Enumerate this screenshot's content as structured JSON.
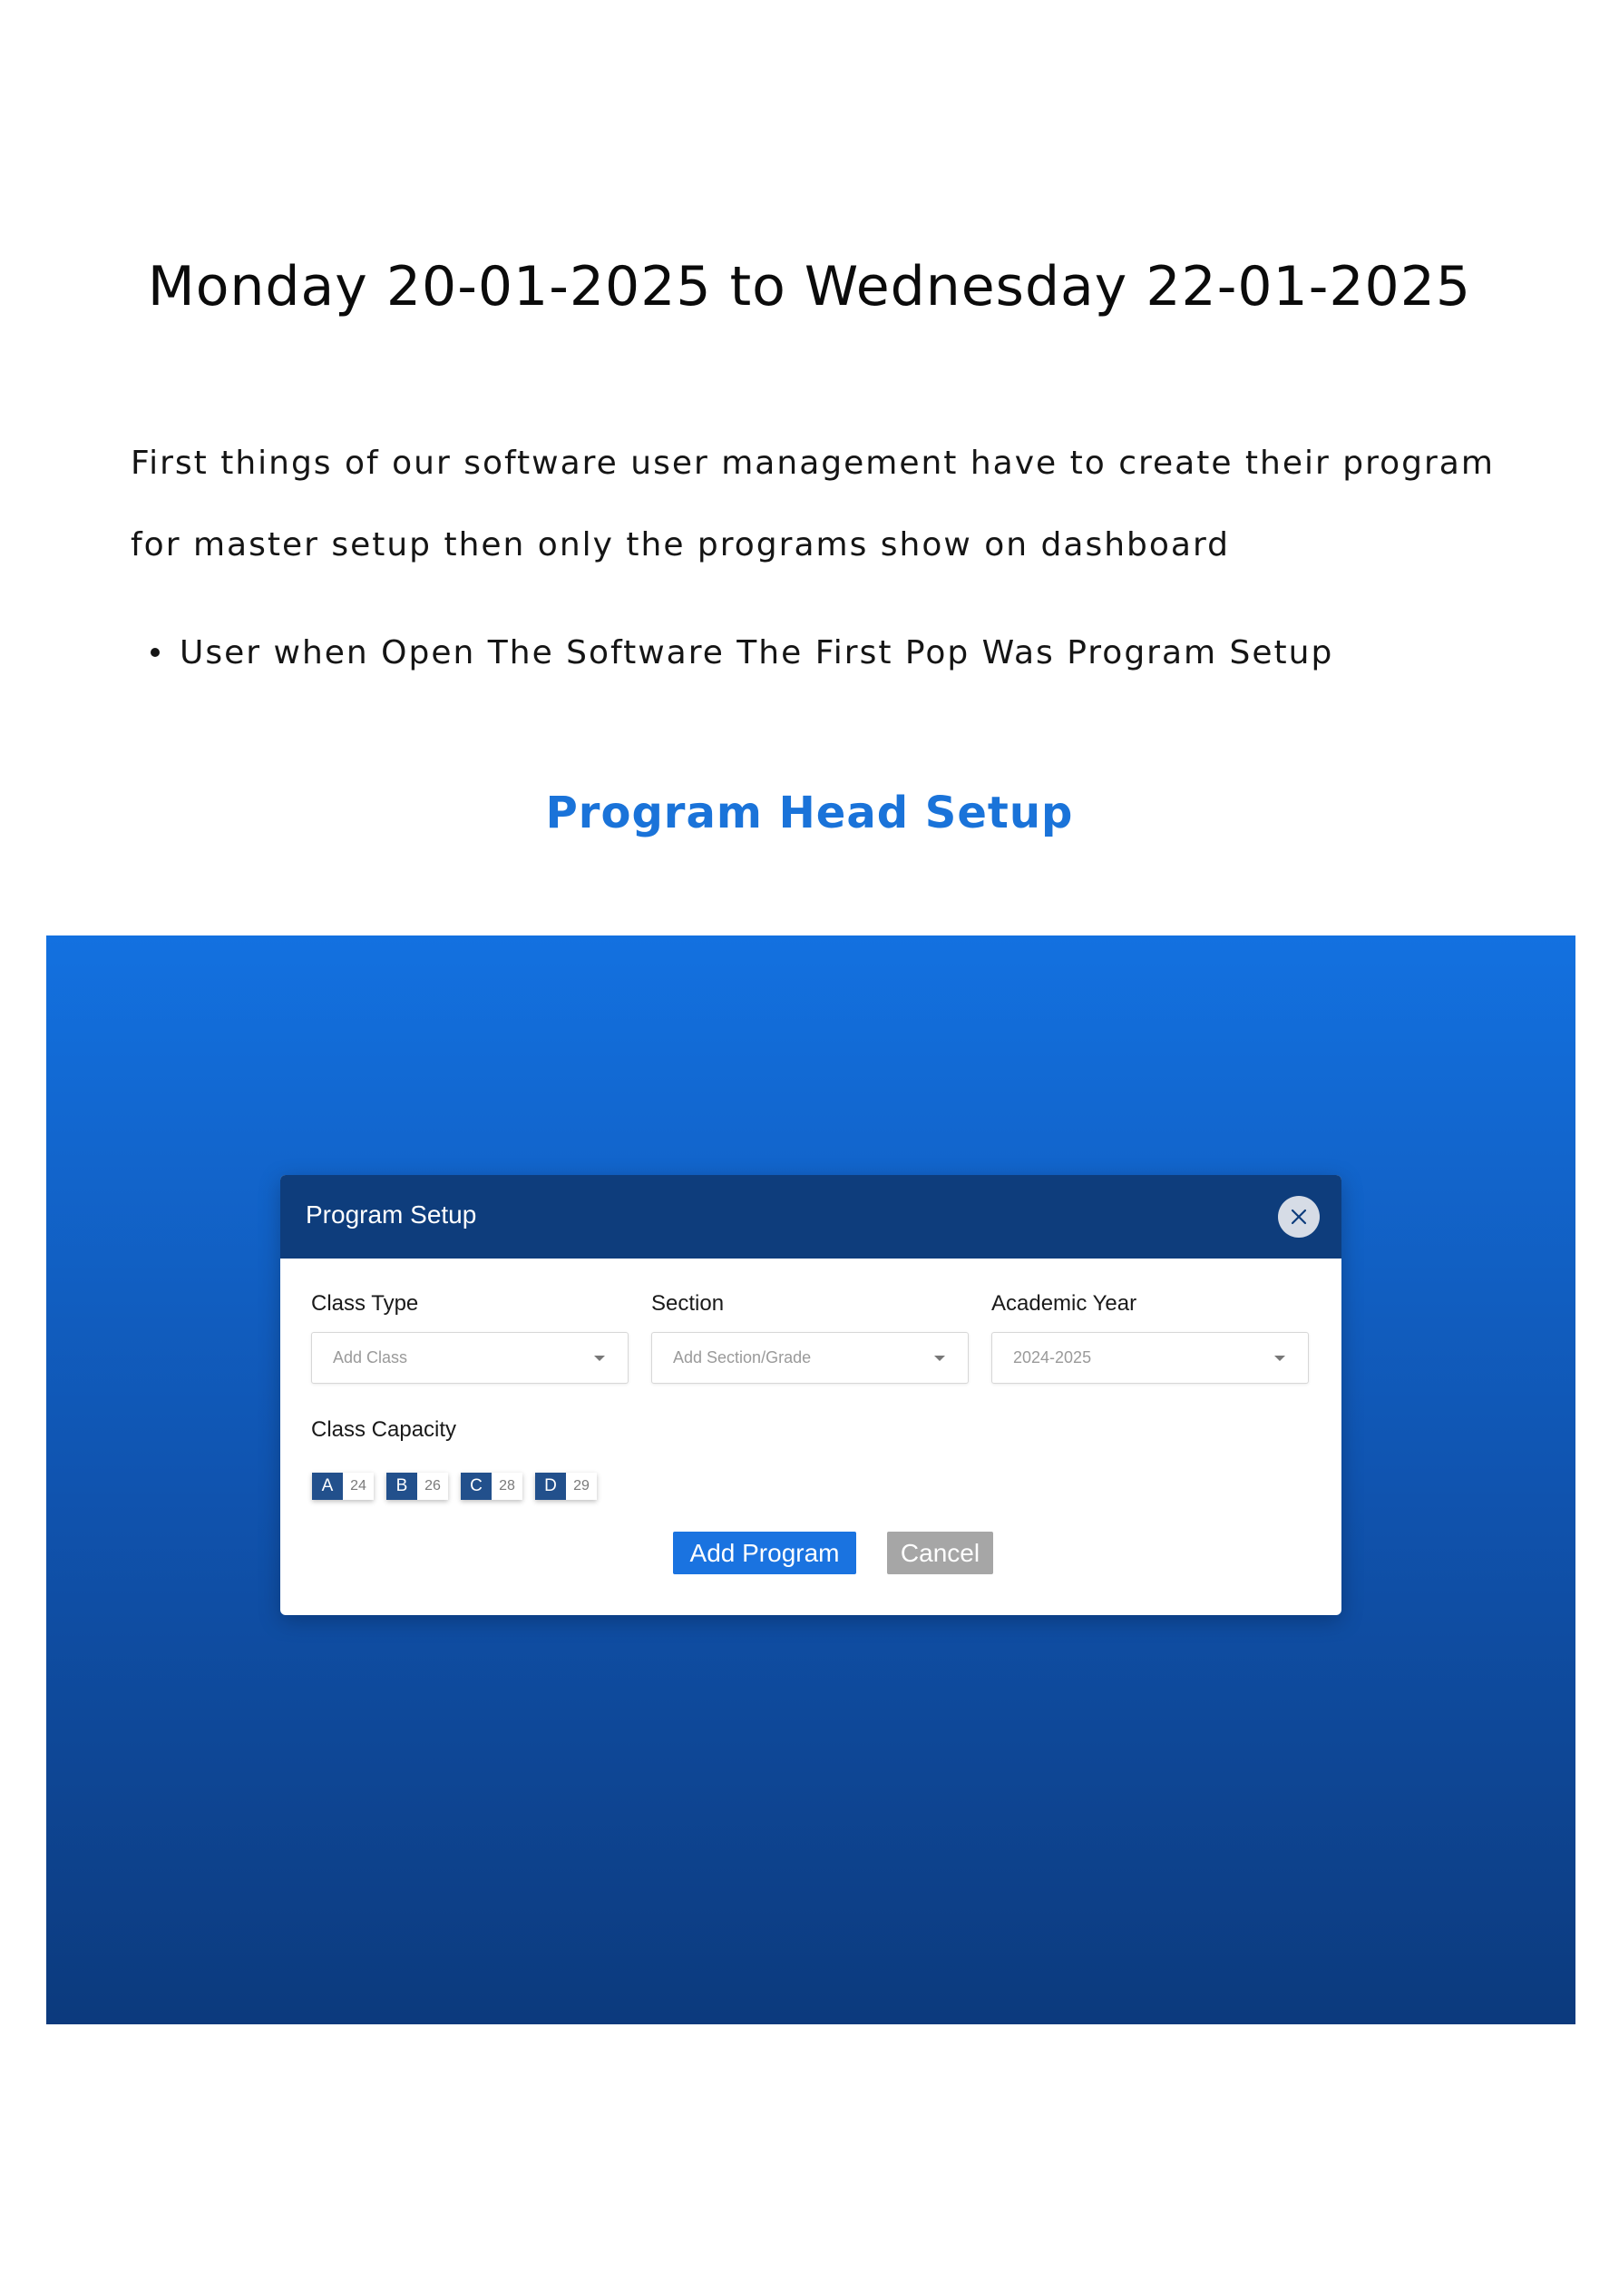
{
  "heading": "Monday 20-01-2025 to Wednesday 22-01-2025",
  "intro": "First things of our software user management have to create their program for master setup then only the programs show on dashboard",
  "bullets": [
    "User when Open The Software The First Pop Was Program Setup"
  ],
  "subheading": "Program Head Setup",
  "colors": {
    "subheading": "#1a73d9",
    "modal_header": "#0e3d7c",
    "primary_button": "#1a73e0",
    "cancel_button": "#a6a6a6",
    "capacity_chip": "#22508c"
  },
  "modal": {
    "title": "Program Setup",
    "close_icon": "close-icon",
    "fields": {
      "class_type": {
        "label": "Class Type",
        "placeholder": "Add Class"
      },
      "section": {
        "label": "Section",
        "placeholder": "Add Section/Grade"
      },
      "academic_year": {
        "label": "Academic Year",
        "value": "2024-2025"
      }
    },
    "capacity": {
      "label": "Class Capacity",
      "items": [
        {
          "letter": "A",
          "count": "24"
        },
        {
          "letter": "B",
          "count": "26"
        },
        {
          "letter": "C",
          "count": "28"
        },
        {
          "letter": "D",
          "count": "29"
        }
      ]
    },
    "buttons": {
      "add": "Add Program",
      "cancel": "Cancel"
    }
  }
}
